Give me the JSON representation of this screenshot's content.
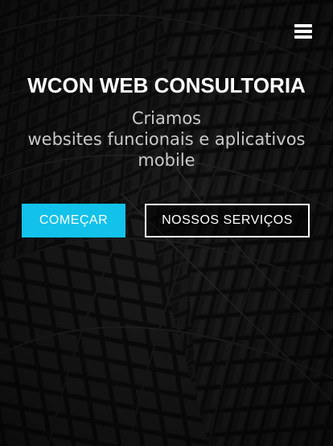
{
  "header": {
    "menu_icon": "hamburger-menu-icon"
  },
  "hero": {
    "title": "WCON WEB CONSULTORIA",
    "subtitle_lines": [
      "Criamos",
      "websites funcionais e aplicativos",
      "mobile"
    ],
    "primary_button_label": "COMEÇAR",
    "secondary_button_label": "NOSSOS SERVIÇOS"
  },
  "colors": {
    "accent": "#12c2ea",
    "text": "#ffffff",
    "subtitle": "#c9c9c9",
    "background": "#111111"
  }
}
